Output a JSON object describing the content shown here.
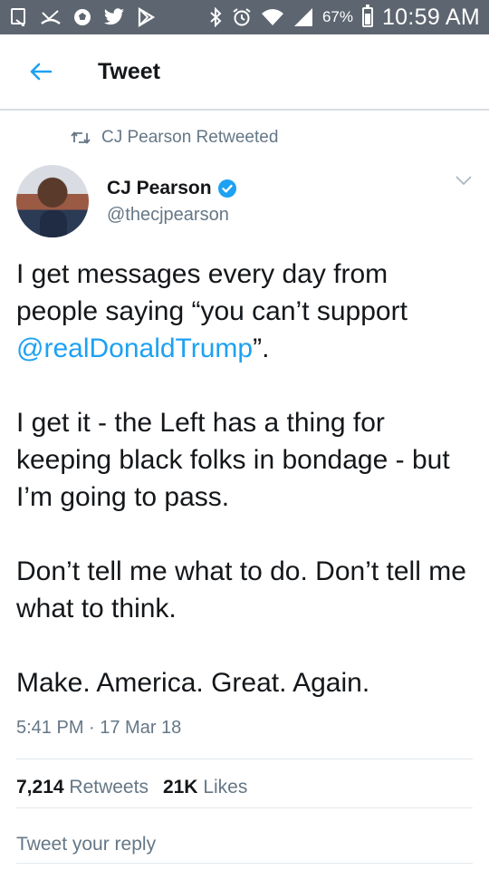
{
  "status_bar": {
    "battery_percent": "67%",
    "battery_level": 0.67,
    "time": "10:59 AM",
    "icons": [
      "screenshot-icon",
      "missed-call-icon",
      "soccer-ball-icon",
      "twitter-bird-icon",
      "play-store-icon",
      "bluetooth-icon",
      "alarm-icon",
      "wifi-icon",
      "signal-icon",
      "battery-icon"
    ]
  },
  "app_bar": {
    "title": "Tweet",
    "back_icon": "back-arrow-icon"
  },
  "tweet": {
    "retweet_label": "CJ Pearson Retweeted",
    "author": {
      "name": "CJ Pearson",
      "handle": "@thecjpearson",
      "verified": true
    },
    "body": {
      "p1_before": "I get messages every day from people saying “you can’t support ",
      "p1_mention": "@realDonaldTrump",
      "p1_after": "”.",
      "p2": "I get it - the Left has a thing for keeping black folks in bondage - but I’m going to pass.",
      "p3": "Don’t tell me what to do. Don’t tell me what to think.",
      "p4": "Make. America. Great. Again."
    },
    "timestamp": "5:41 PM · 17 Mar 18",
    "stats": {
      "retweets_count": "7,214",
      "retweets_label": "Retweets",
      "likes_count": "21K",
      "likes_label": "Likes"
    },
    "reply_placeholder": "Tweet your reply"
  },
  "colors": {
    "status_bar_bg": "#5d6670",
    "link_blue": "#1da1f2",
    "secondary_text": "#657786",
    "primary_text": "#14171a"
  }
}
